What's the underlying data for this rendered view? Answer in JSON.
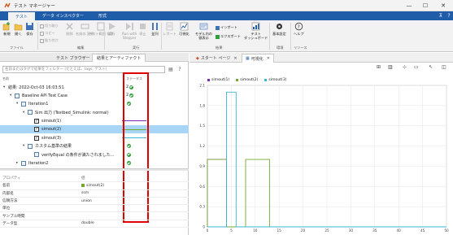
{
  "window": {
    "title": "テスト マネージャー",
    "minimize": "—",
    "maximize": "☐",
    "close": "✕"
  },
  "tabs": [
    {
      "label": "テスト",
      "active": true
    },
    {
      "label": "データ インスペクター",
      "active": false
    },
    {
      "label": "形式",
      "active": false
    }
  ],
  "ribbon": {
    "buttons": [
      {
        "label": "新規",
        "icon": "new-icon"
      },
      {
        "label": "開く",
        "icon": "open-folder-icon"
      },
      {
        "label": "保存",
        "icon": "save-icon"
      },
      {
        "label": "実行",
        "icon": "run-icon",
        "disabled": true
      },
      {
        "label": "Run with\nStepper",
        "icon": "stepper-icon",
        "disabled": true
      },
      {
        "label": "停止",
        "icon": "stop-icon",
        "disabled": true
      },
      {
        "label": "並列",
        "icon": "parallel-icon"
      },
      {
        "label": "レポート",
        "icon": "report-icon",
        "disabled": true
      },
      {
        "label": "可視化",
        "icon": "visualize-icon"
      },
      {
        "label": "モデル内の\n値表示",
        "icon": "model-values-icon"
      },
      {
        "label": "テスト\nダッシュボード",
        "icon": "dashboard-icon"
      },
      {
        "label": "基本設定",
        "icon": "gear-icon"
      },
      {
        "label": "ヘルプ",
        "icon": "help-icon"
      }
    ],
    "small_items": [
      "切り取り",
      "コピー",
      "貼り付け",
      "削除",
      "名前の\n変更",
      "テスト範囲\n検索",
      "インポート",
      "エクスポート"
    ],
    "groups": [
      "ファイル",
      "編集",
      "実行",
      "結果",
      "環境",
      "リソース"
    ]
  },
  "left_panel": {
    "tabs": [
      "テスト ブラウザー",
      "結果とアーティファクト"
    ],
    "filter_placeholder": "名前またはタグで結果をフィルター (たとえば、tags: テスト)",
    "col_name": "名前",
    "col_status": "ステータス",
    "tree": [
      {
        "label": "結果: 2022-Oct-03 16:03:51",
        "indent": 0,
        "expander": "▾",
        "status_text": "2"
      },
      {
        "label": "Baseline API Test Case",
        "indent": 1,
        "expander": "▾",
        "status_text": "2"
      },
      {
        "label": "Iteration1",
        "indent": 2,
        "expander": "▾",
        "status_text": ""
      },
      {
        "label": "Sim 出力 (Testbed_Simulink: normal)",
        "indent": 3,
        "expander": "▾",
        "status_text": ""
      },
      {
        "label": "simout(1)",
        "indent": 4,
        "check": true,
        "line_color": "#7d2ab6"
      },
      {
        "label": "simout(2)",
        "indent": 4,
        "check": true,
        "selected": true,
        "line_color": "#74a82d"
      },
      {
        "label": "simout(3)",
        "indent": 4,
        "check": true,
        "line_color": "#3bb6d6"
      },
      {
        "label": "カスタム基準の結果",
        "indent": 3,
        "expander": "▾",
        "status_text": ""
      },
      {
        "label": "verifyEqual の条件が満たされました...",
        "indent": 4,
        "status_text": ""
      },
      {
        "label": "Iteration2",
        "indent": 2,
        "expander": "▸",
        "status_text": ""
      }
    ],
    "properties": [
      {
        "key": "プロパティ",
        "value": "値",
        "header": true
      },
      {
        "key": "名前",
        "value": "simout(2)",
        "swatch": "#74a82d"
      },
      {
        "key": "内部名",
        "value": "ssm"
      },
      {
        "key": "信頼方法",
        "value": "union"
      },
      {
        "key": "単位",
        "value": ""
      },
      {
        "key": "サンプル時間",
        "value": ""
      },
      {
        "key": "データ型",
        "value": "double"
      }
    ]
  },
  "right_panel": {
    "doc_tabs": [
      {
        "label": "スタート ページ",
        "active": false
      },
      {
        "label": "可視化",
        "active": true
      }
    ],
    "close_glyph": "✕"
  },
  "chart_data": {
    "type": "line",
    "title": "",
    "xlabel": "",
    "ylabel": "",
    "xlim": [
      0,
      50
    ],
    "ylim": [
      0,
      2.1
    ],
    "xticks": [
      0,
      5,
      10,
      15,
      20,
      25,
      30,
      35,
      40,
      45,
      50
    ],
    "yticks": [
      0,
      0.3,
      0.6,
      0.9,
      1.2,
      1.5,
      1.8,
      2.1
    ],
    "grid": true,
    "legend_position": "top-left",
    "series": [
      {
        "name": "simout(1)",
        "color": "#7d2ab6",
        "x": [
          0,
          0,
          4,
          4,
          8,
          8,
          50
        ],
        "y": [
          0,
          1,
          1,
          0,
          0,
          0,
          0
        ]
      },
      {
        "name": "simout(2)",
        "color": "#74a82d",
        "x": [
          0,
          0,
          4,
          4,
          8,
          8,
          13,
          13,
          50
        ],
        "y": [
          0,
          1,
          1,
          0,
          0,
          1,
          1,
          0,
          0
        ]
      },
      {
        "name": "simout(3)",
        "color": "#3bb6d6",
        "x": [
          0,
          4,
          4,
          6,
          6,
          50
        ],
        "y": [
          0,
          0,
          2,
          2,
          0,
          0
        ]
      }
    ]
  }
}
